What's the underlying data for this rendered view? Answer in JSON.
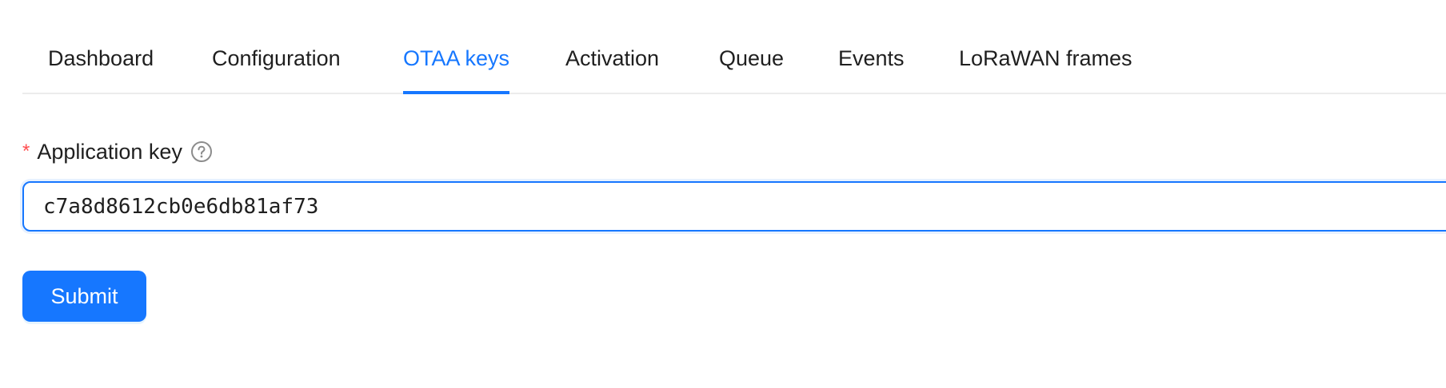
{
  "tabs": [
    {
      "label": "Dashboard",
      "active": false
    },
    {
      "label": "Configuration",
      "active": false
    },
    {
      "label": "OTAA keys",
      "active": true
    },
    {
      "label": "Activation",
      "active": false
    },
    {
      "label": "Queue",
      "active": false
    },
    {
      "label": "Events",
      "active": false
    },
    {
      "label": "LoRaWAN frames",
      "active": false
    }
  ],
  "form": {
    "required_mark": "*",
    "app_key_label": "Application key",
    "help_icon": "question-circle-icon",
    "app_key_value": "c7a8d8612cb0e6db81af73",
    "submit_label": "Submit"
  },
  "colors": {
    "accent": "#1677ff",
    "required": "#ff4d4f",
    "text": "#1f1f1f",
    "divider": "#ececec"
  }
}
